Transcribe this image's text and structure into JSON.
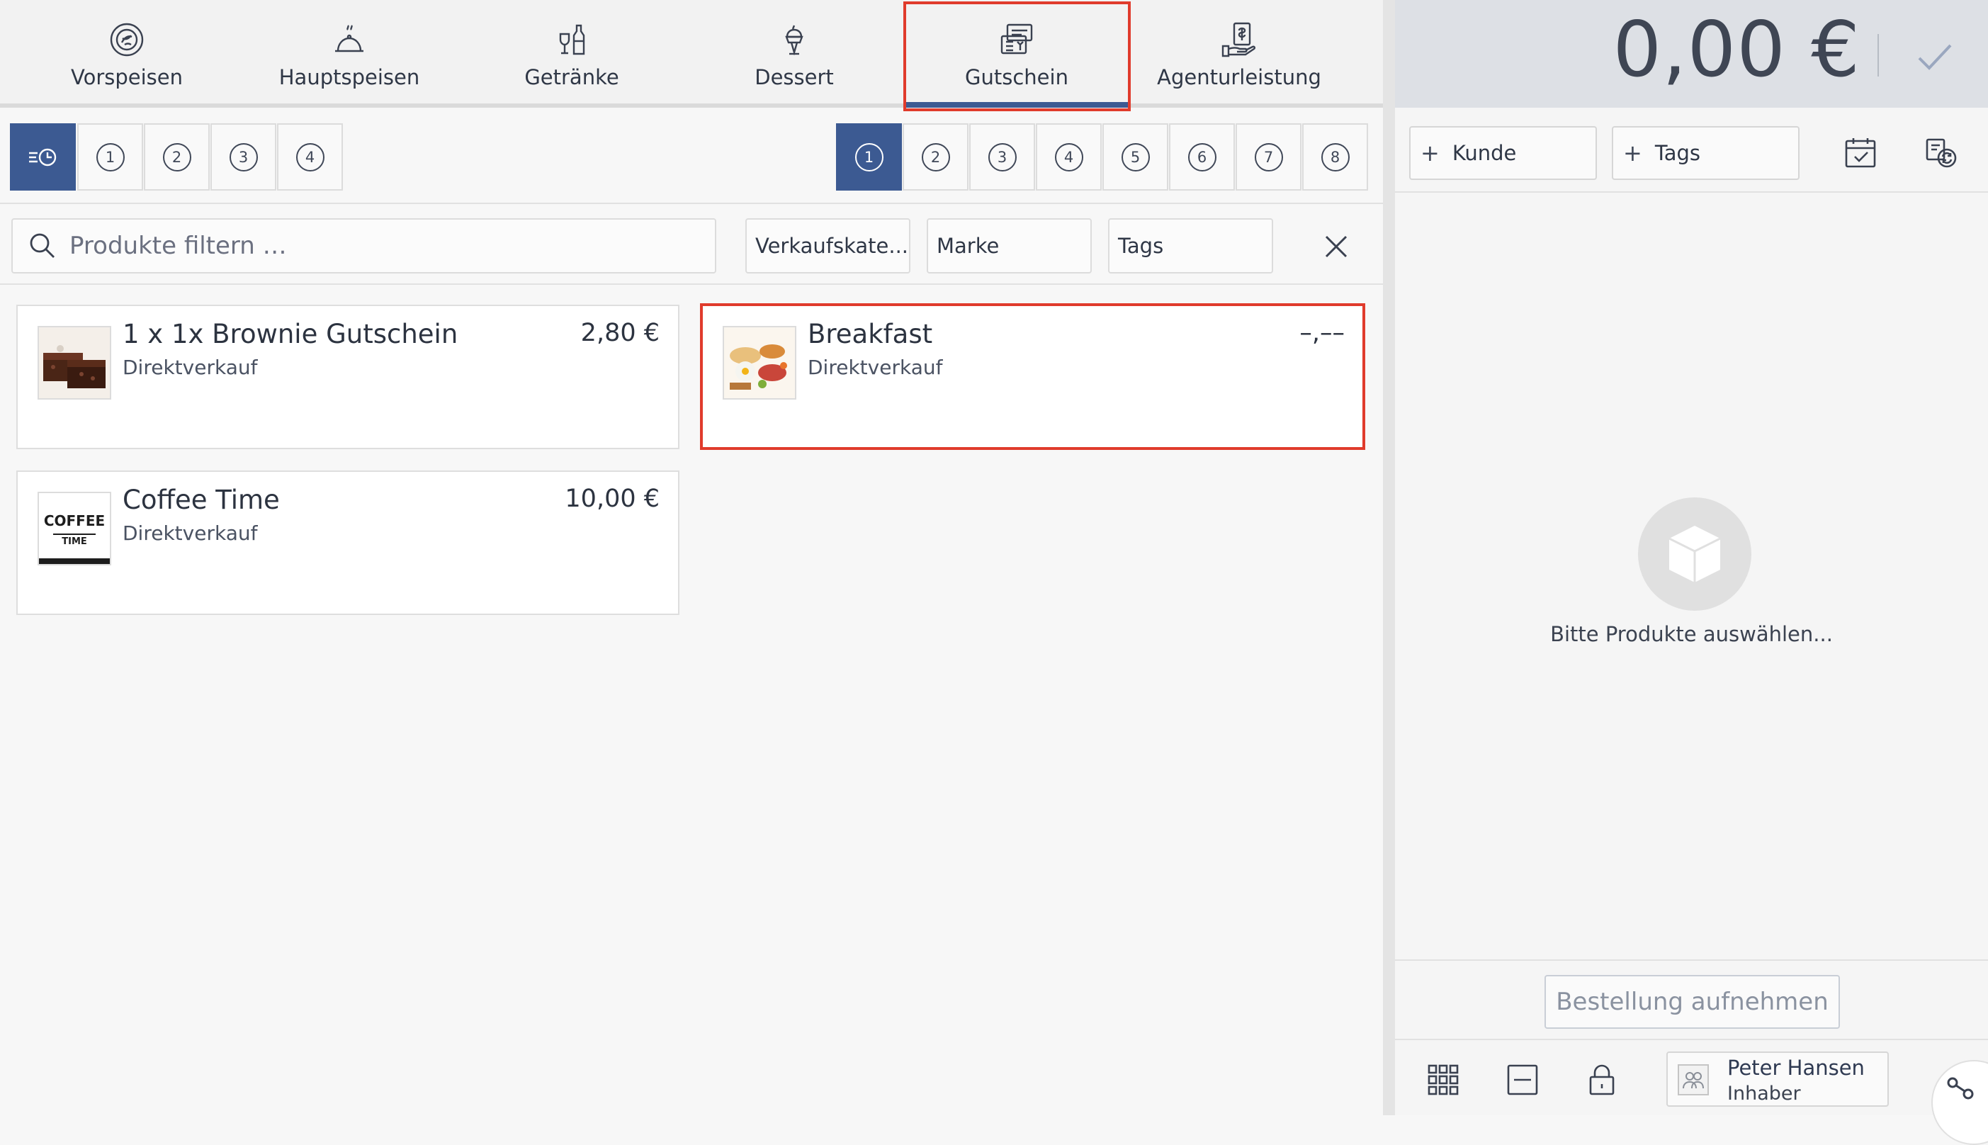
{
  "categories": [
    {
      "label": "Vorspeisen",
      "icon": "salad-icon"
    },
    {
      "label": "Hauptspeisen",
      "icon": "cloche-icon"
    },
    {
      "label": "Getränke",
      "icon": "drinks-icon"
    },
    {
      "label": "Dessert",
      "icon": "ice-cream-icon"
    },
    {
      "label": "Gutschein",
      "icon": "voucher-icon",
      "active": true
    },
    {
      "label": "Agenturleistung",
      "icon": "service-hand-icon"
    }
  ],
  "left_numbers": [
    "1",
    "2",
    "3",
    "4"
  ],
  "right_numbers": [
    "1",
    "2",
    "3",
    "4",
    "5",
    "6",
    "7",
    "8"
  ],
  "filter": {
    "search_placeholder": "Produkte filtern …",
    "sales_category": "Verkaufskate...",
    "brand": "Marke",
    "tags": "Tags"
  },
  "products": [
    {
      "name": "1 x 1x Brownie Gutschein",
      "subtitle": "Direktverkauf",
      "price": "2,80 €",
      "image": "brownie"
    },
    {
      "name": "Breakfast",
      "subtitle": "Direktverkauf",
      "price": "–,––",
      "image": "breakfast"
    },
    {
      "name": "Coffee Time",
      "subtitle": "Direktverkauf",
      "price": "10,00 €",
      "image": "coffee-time-logo"
    }
  ],
  "coffee_logo_text": {
    "line1": "COFFEE",
    "line2": "TIME"
  },
  "cart": {
    "total": "0,00 €",
    "customer_button": "Kunde",
    "tags_button": "Tags",
    "empty_message": "Bitte Produkte auswählen...",
    "order_button": "Bestellung aufnehmen"
  },
  "user": {
    "name": "Peter Hansen",
    "role": "Inhaber"
  },
  "colors": {
    "accent": "#3c5a92",
    "highlight": "#e03b2c"
  }
}
